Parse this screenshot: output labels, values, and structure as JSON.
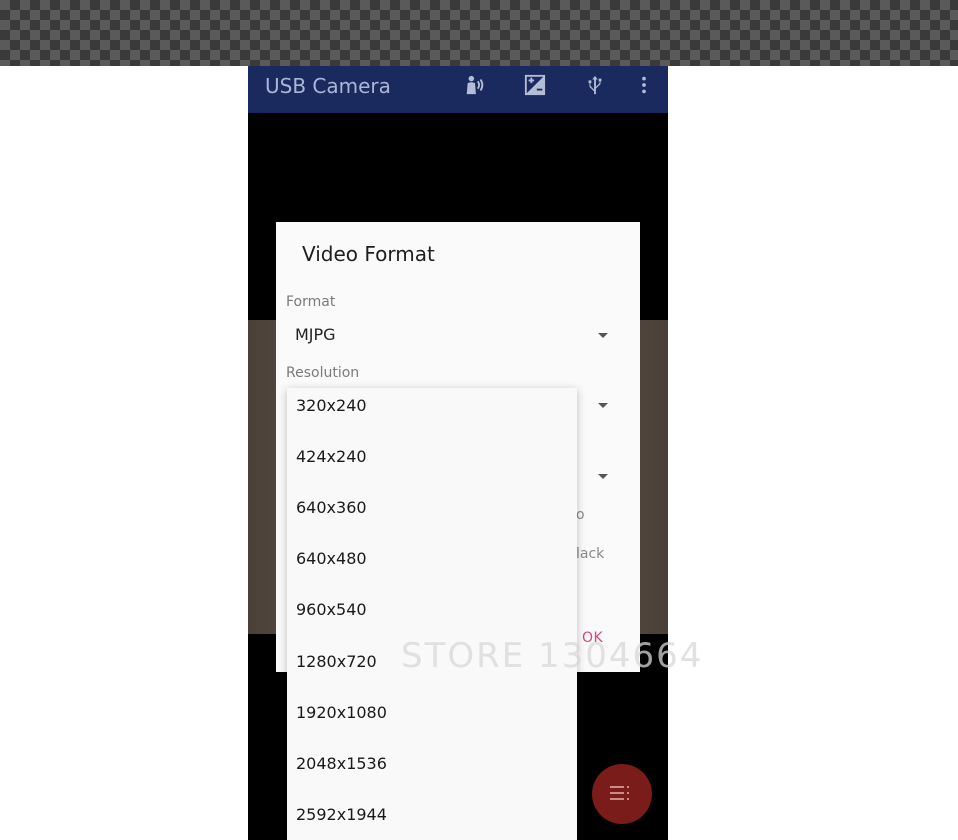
{
  "app": {
    "title": "USB Camera"
  },
  "appbar_icons": [
    "voice-icon",
    "exposure-icon",
    "usb-icon",
    "more-vert-icon"
  ],
  "dialog": {
    "title": "Video Format",
    "format_label": "Format",
    "format_value": "MJPG",
    "resolution_label": "Resolution",
    "partial_row_1": "o",
    "partial_row_2": "lack",
    "ok_label": "OK"
  },
  "resolution_options": [
    "320x240",
    "424x240",
    "640x360",
    "640x480",
    "960x540",
    "1280x720",
    "1920x1080",
    "2048x1536",
    "2592x1944"
  ],
  "watermark": "STORE 1304664",
  "colors": {
    "appbar": "#1a2a5e",
    "accent": "#d4487a",
    "fab": "#7a1c1a"
  }
}
